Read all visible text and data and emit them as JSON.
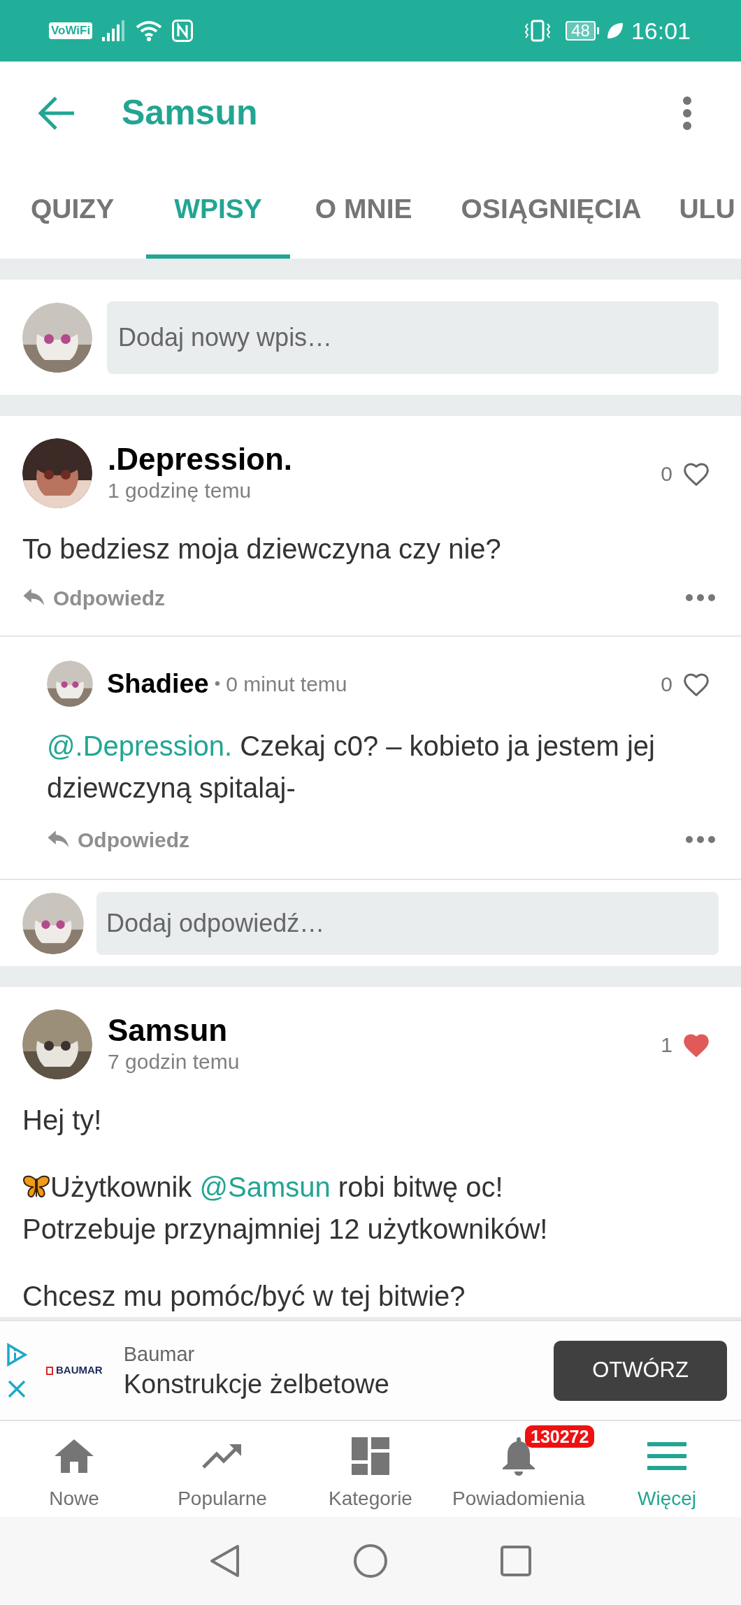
{
  "status_bar": {
    "vowifi": "VoWiFi",
    "battery": "48",
    "time": "16:01"
  },
  "header": {
    "title": "Samsun"
  },
  "tabs": [
    {
      "label": "QUIZY",
      "selected": false
    },
    {
      "label": "WPISY",
      "selected": true
    },
    {
      "label": "O MNIE",
      "selected": false
    },
    {
      "label": "OSIĄGNIĘCIA",
      "selected": false
    },
    {
      "label": "ULU",
      "selected": false
    }
  ],
  "new_post": {
    "placeholder": "Dodaj nowy wpis…"
  },
  "posts": [
    {
      "author": ".Depression.",
      "time": "1 godzinę temu",
      "likes": "0",
      "liked": false,
      "paragraphs": [
        [
          {
            "kind": "text",
            "text": "To bedziesz moja dziewczyna czy nie?"
          }
        ]
      ],
      "reply_label": "Odpowiedz",
      "replies": [
        {
          "author": "Shadiee",
          "separator": "•",
          "time": "0 minut temu",
          "likes": "0",
          "liked": false,
          "paragraphs": [
            [
              {
                "kind": "mention",
                "text": "@.Depression."
              },
              {
                "kind": "text",
                "text": " Czekaj c0? – kobieto ja jestem jej dziewczyną spitalaj-"
              }
            ]
          ],
          "reply_label": "Odpowiedz"
        }
      ],
      "reply_field": {
        "placeholder": "Dodaj odpowiedź…"
      }
    },
    {
      "author": "Samsun",
      "time": "7 godzin temu",
      "likes": "1",
      "liked": true,
      "paragraphs": [
        [
          {
            "kind": "text",
            "text": "Hej ty!"
          }
        ],
        [
          {
            "kind": "emoji"
          },
          {
            "kind": "text",
            "text": "Użytkownik "
          },
          {
            "kind": "mention",
            "text": "@Samsun"
          },
          {
            "kind": "text",
            "text": " robi bitwę oc!\nPotrzebuje przynajmniej 12 użytkowników!"
          }
        ],
        [
          {
            "kind": "text",
            "text": "Chcesz mu pomóc/być w tej bitwie?"
          }
        ]
      ]
    }
  ],
  "ad": {
    "logo": "BAUMAR",
    "advertiser": "Baumar",
    "headline": "Konstrukcje żelbetowe",
    "button": "OTWÓRZ"
  },
  "bottom_nav": [
    {
      "label": "Nowe",
      "kind": "home",
      "selected": false
    },
    {
      "label": "Popularne",
      "kind": "trending",
      "selected": false
    },
    {
      "label": "Kategorie",
      "kind": "grid",
      "selected": false
    },
    {
      "label": "Powiadomienia",
      "kind": "bell",
      "selected": false,
      "badge": "130272"
    },
    {
      "label": "Więcej",
      "kind": "menu",
      "selected": true
    }
  ]
}
